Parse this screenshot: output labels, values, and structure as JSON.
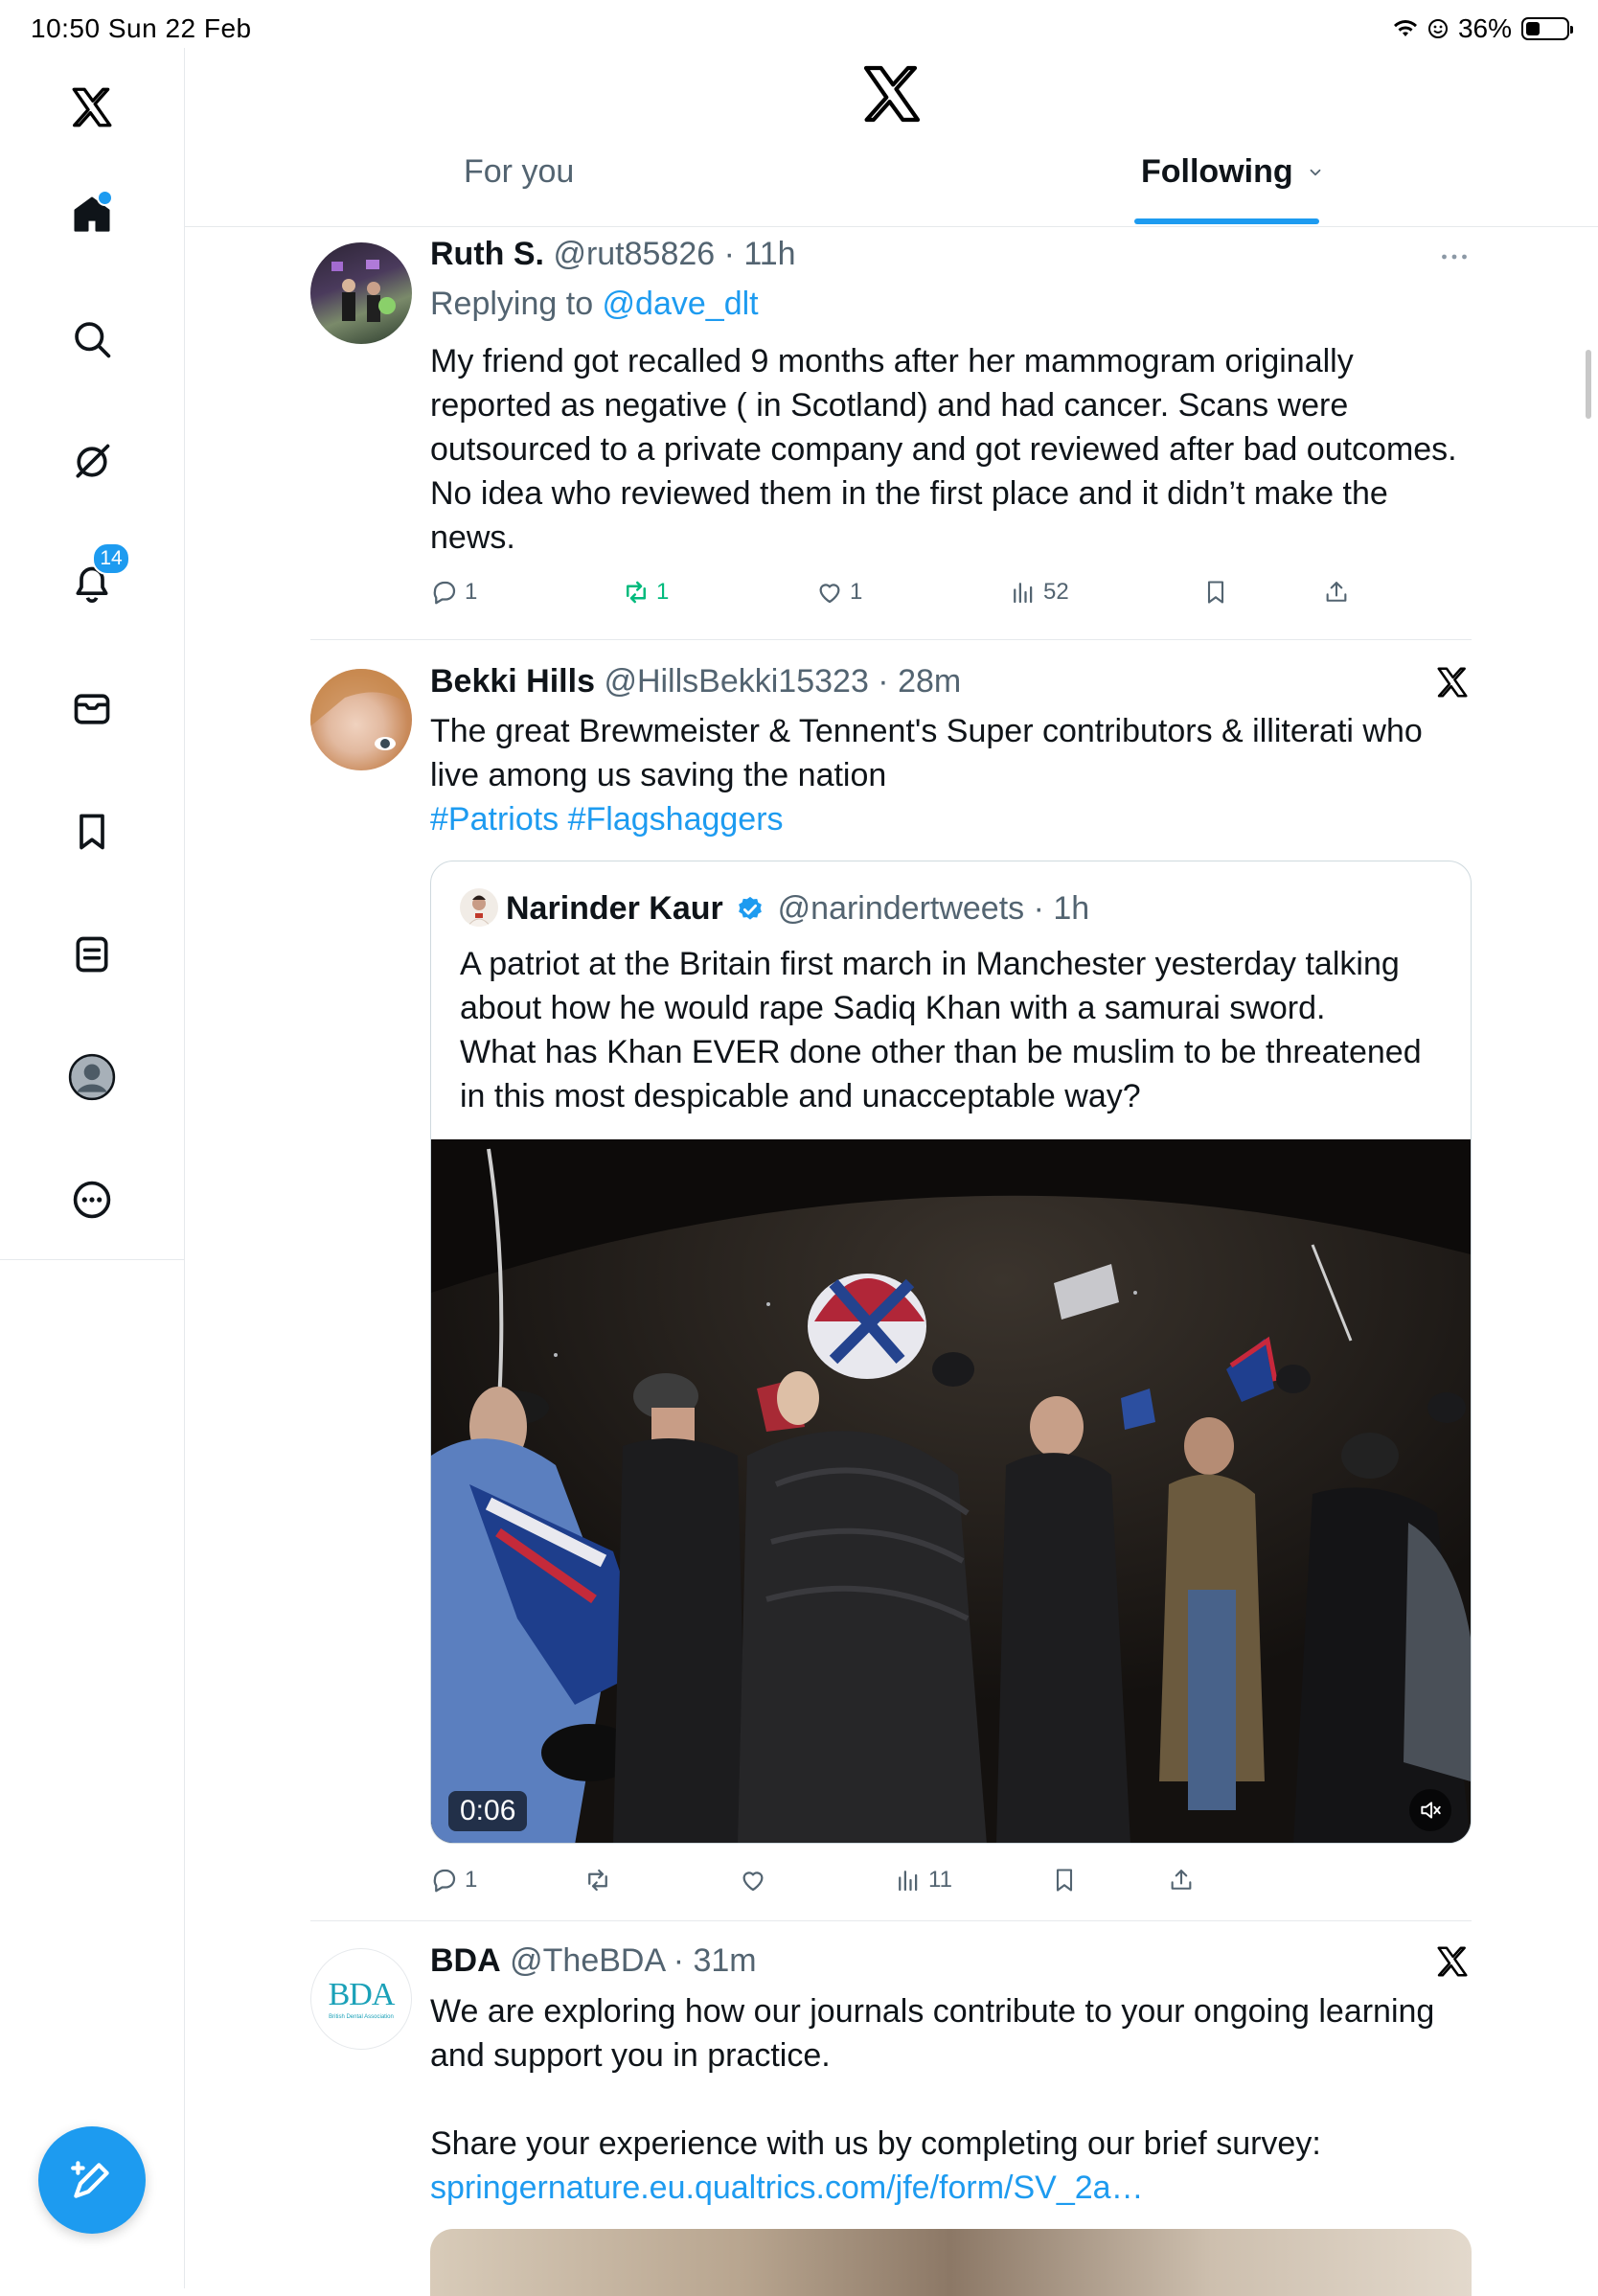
{
  "status_bar": {
    "time_date": "10:50  Sun 22 Feb",
    "battery": "36%",
    "battery_level": 0.36
  },
  "header": {
    "tabs": [
      {
        "label": "For you"
      },
      {
        "label": "Following"
      }
    ]
  },
  "sidebar": {
    "notifications_badge": "14"
  },
  "tweets": [
    {
      "name": "Ruth S.",
      "handle_time": "@rut85826 · 11h",
      "replying_prefix": "Replying to ",
      "replying_to": "@dave_dlt",
      "text": "My friend got recalled 9 months after her mammogram originally reported as negative ( in Scotland) and had cancer. Scans were outsourced to a private company and got reviewed after bad outcomes. No idea who reviewed them in the first place and it didn’t make the news.",
      "replies": "1",
      "reposts": "1",
      "likes": "1",
      "views": "52"
    },
    {
      "name": "Bekki Hills",
      "handle_time": "@HillsBekki15323 · 28m",
      "text": "The great Brewmeister & Tennent's Super contributors & illiterati who live among us saving the nation",
      "hashtags": "#Patriots #Flagshaggers",
      "quote": {
        "name": "Narinder Kaur",
        "handle_time": "@narindertweets · 1h",
        "text_line1": "A patriot at the Britain first march in Manchester yesterday talking about how he would rape Sadiq Khan with a samurai sword.",
        "text_line2": "What has Khan EVER done other than be muslim to be threatened in this most despicable and unacceptable way?",
        "video_duration": "0:06"
      },
      "replies": "1",
      "views": "11"
    },
    {
      "name": "BDA",
      "handle_time": "@TheBDA · 31m",
      "avatar_text": "BDA",
      "avatar_subtext": "British Dental Association",
      "text": "We are exploring how our journals contribute to your ongoing learning and support you in practice.",
      "text2": "Share your experience with us by completing our brief survey:",
      "link": "springernature.eu.qualtrics.com/jfe/form/SV_2a…"
    }
  ],
  "colors": {
    "accent": "#1d9bf0",
    "repost_active": "#00ba7c",
    "text": "#0f1419",
    "muted": "#536471"
  }
}
